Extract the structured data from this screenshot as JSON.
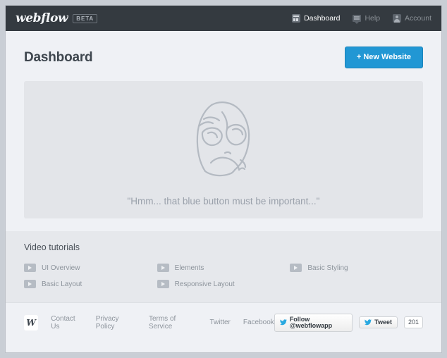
{
  "topbar": {
    "logo_text": "webflow",
    "beta_label": "BETA",
    "nav": [
      {
        "label": "Dashboard",
        "icon": "dashboard-icon",
        "active": true
      },
      {
        "label": "Help",
        "icon": "help-icon",
        "active": false
      },
      {
        "label": "Account",
        "icon": "account-icon",
        "active": false
      }
    ]
  },
  "page": {
    "title": "Dashboard",
    "new_website_label": "+ New Website",
    "accent_color": "#2197d4"
  },
  "hero": {
    "face_icon": "hmm-face-illustration",
    "quote": "\"Hmm... that blue button must be important...\""
  },
  "tutorials": {
    "title": "Video tutorials",
    "items": [
      {
        "label": "UI Overview",
        "icon": "play-icon"
      },
      {
        "label": "Elements",
        "icon": "play-icon"
      },
      {
        "label": "Basic Styling",
        "icon": "play-icon"
      },
      {
        "label": "Basic Layout",
        "icon": "play-icon"
      },
      {
        "label": "Responsive Layout",
        "icon": "play-icon"
      }
    ]
  },
  "footer": {
    "logo_letter": "W",
    "links": [
      {
        "label": "Contact Us"
      },
      {
        "label": "Privacy Policy"
      },
      {
        "label": "Terms of Service"
      },
      {
        "label": "Twitter"
      },
      {
        "label": "Facebook"
      }
    ],
    "follow_label": "Follow @webflowapp",
    "tweet_label": "Tweet",
    "tweet_count": "201"
  }
}
